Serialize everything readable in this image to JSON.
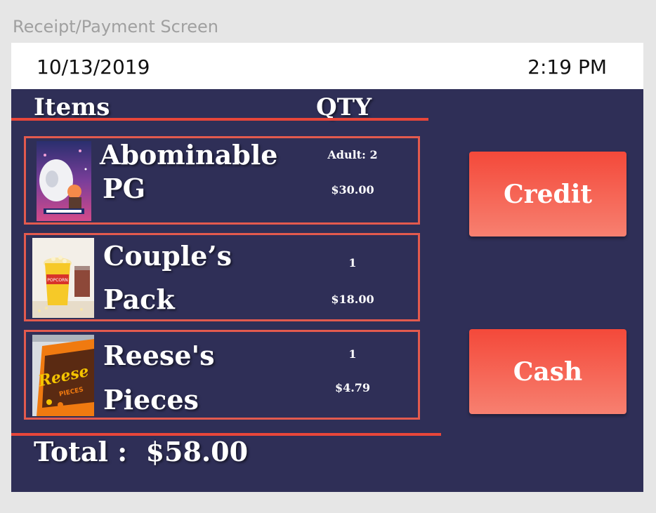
{
  "window": {
    "title": "Receipt/Payment Screen"
  },
  "header": {
    "date": "10/13/2019",
    "time": "2:19 PM"
  },
  "columns": {
    "items": "Items",
    "qty": "QTY"
  },
  "items": [
    {
      "name_line1": "Abominable",
      "name_line2": "PG",
      "qty": "Adult: 2",
      "price": "$30.00",
      "image": "abominable-poster-image"
    },
    {
      "name_line1": "Couple’s",
      "name_line2": "Pack",
      "qty": "1",
      "price": "$18.00",
      "image": "popcorn-drink-image"
    },
    {
      "name_line1": "Reese's",
      "name_line2": "Pieces",
      "qty": "1",
      "price": "$4.79",
      "image": "reeses-pieces-image"
    }
  ],
  "total": {
    "label": "Total :",
    "amount": "$58.00"
  },
  "buttons": {
    "credit": "Credit",
    "cash": "Cash"
  },
  "colors": {
    "background": "#2f2f57",
    "accent": "#e8463a",
    "button_top": "#f4493a",
    "button_bottom": "#f78070"
  }
}
